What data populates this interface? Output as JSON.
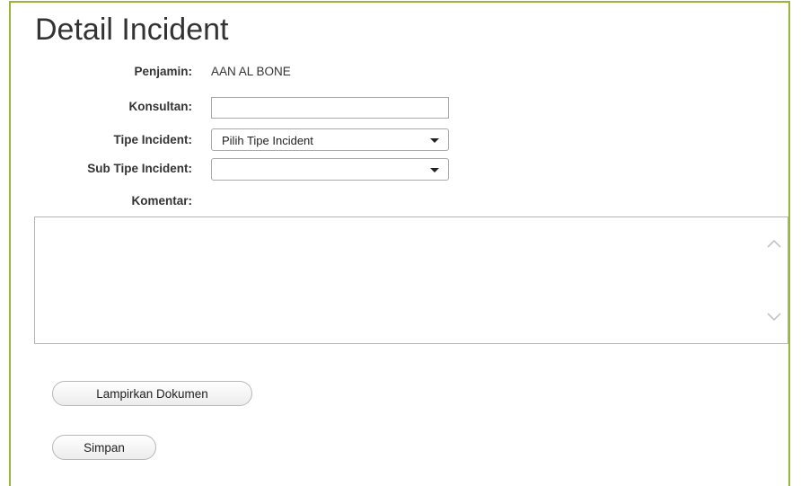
{
  "page": {
    "title": "Detail Incident"
  },
  "form": {
    "penjamin_label": "Penjamin:",
    "penjamin_value": "AAN AL BONE",
    "konsultan_label": "Konsultan:",
    "konsultan_value": "",
    "tipe_incident_label": "Tipe Incident:",
    "tipe_incident_selected": "Pilih Tipe Incident",
    "sub_tipe_incident_label": "Sub Tipe Incident:",
    "sub_tipe_incident_selected": "",
    "komentar_label": "Komentar:",
    "komentar_value": ""
  },
  "actions": {
    "attach_label": "Lampirkan Dokumen",
    "save_label": "Simpan"
  },
  "colors": {
    "panel_border": "#9bb53a",
    "text": "#333333",
    "input_border": "#a9a9a9"
  },
  "icons": {
    "select_caret": "chevron-down-icon",
    "scroll_up": "chevron-up-icon",
    "scroll_down": "chevron-down-icon"
  }
}
